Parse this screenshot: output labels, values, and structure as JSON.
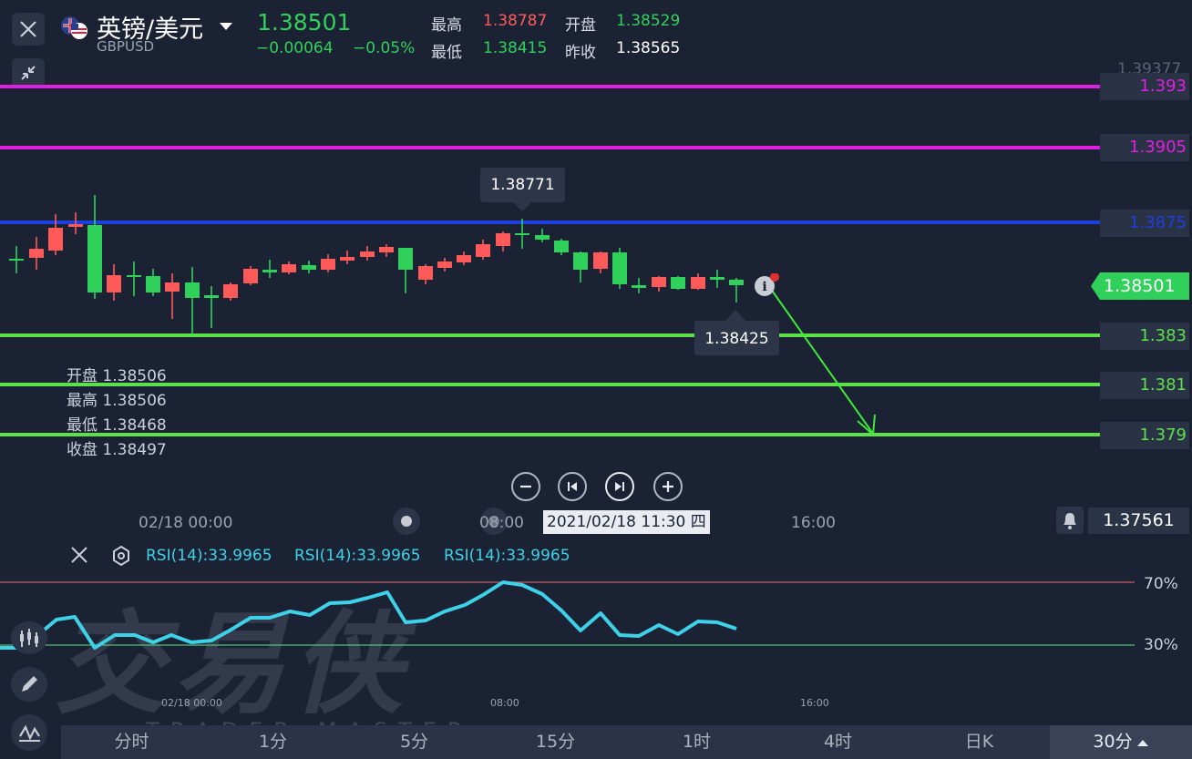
{
  "header": {
    "pair_name": "英镑/美元",
    "symbol": "GBPUSD",
    "last_price": "1.38501",
    "change": "−0.00064",
    "change_pct": "−0.05%",
    "high_label": "最高",
    "high_value": "1.38787",
    "open_label": "开盘",
    "open_value": "1.38529",
    "low_label": "最低",
    "low_value": "1.38415",
    "prev_close_label": "昨收",
    "prev_close_value": "1.38565"
  },
  "price_axis": {
    "top_value": "1.39377",
    "levels": [
      {
        "label": "1.393",
        "color": "#e020e0"
      },
      {
        "label": "1.3905",
        "color": "#e020e0"
      },
      {
        "label": "1.3875",
        "color": "#1e3fe0"
      },
      {
        "label": "1.383",
        "color": "#5ee04a"
      },
      {
        "label": "1.381",
        "color": "#5ee04a"
      },
      {
        "label": "1.379",
        "color": "#5ee04a"
      }
    ],
    "current_price": "1.38501",
    "bottom_value": "1.37561"
  },
  "chart_annotations": {
    "high_callout": "1.38771",
    "low_callout": "1.38425"
  },
  "ohlc_panel": {
    "open_label": "开盘",
    "open": "1.38506",
    "high_label": "最高",
    "high": "1.38506",
    "low_label": "最低",
    "low": "1.38468",
    "close_label": "收盘",
    "close": "1.38497"
  },
  "time_axis": {
    "t1": "02/18 00:00",
    "t2": "08:00",
    "crosshair": "2021/02/18 11:30 四",
    "t3": "16:00"
  },
  "rsi": {
    "labels": [
      "RSI(14):33.9965",
      "RSI(14):33.9965",
      "RSI(14):33.9965"
    ],
    "upper": "70%",
    "lower": "30%",
    "t1": "02/18 00:00",
    "t2": "08:00",
    "t3": "16:00"
  },
  "watermark": {
    "chinese": "交易侠",
    "english": "TRADER MASTER"
  },
  "tabs": [
    "分时",
    "1分",
    "5分",
    "15分",
    "1时",
    "4时",
    "日K",
    "30分"
  ],
  "active_tab": "30分",
  "colors": {
    "up": "#2fd15a",
    "down": "#ff5a5a",
    "rsi": "#3fd1e8",
    "magenta": "#e020e0",
    "blue": "#1e3fe0",
    "green_line": "#5ee04a"
  },
  "icons": [
    "close-icon",
    "collapse-icon",
    "flag-icon",
    "dropdown-icon",
    "info-icon",
    "zoom-out-icon",
    "prev-icon",
    "next-icon",
    "zoom-in-icon",
    "bell-icon",
    "settings-icon",
    "candle-icon",
    "pen-icon",
    "indicator-icon"
  ]
}
